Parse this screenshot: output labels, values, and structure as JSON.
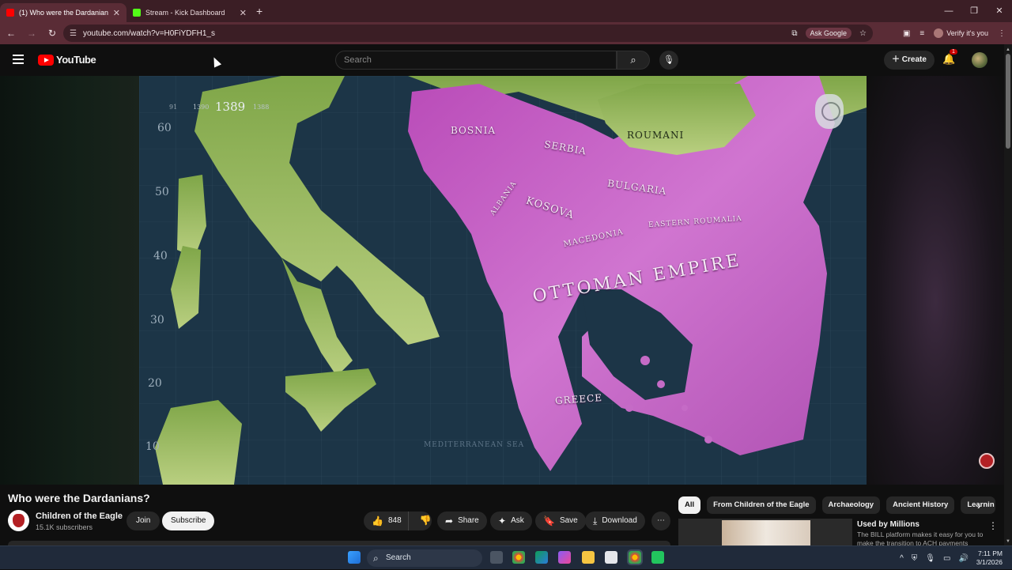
{
  "browser": {
    "tabs": [
      {
        "title": "(1) Who were the Dardanians?",
        "favicon_color": "#ff0000",
        "active": true
      },
      {
        "title": "Stream - Kick Dashboard",
        "favicon_color": "#53fc18",
        "active": false
      }
    ],
    "url": "youtube.com/watch?v=H0FiYDFH1_s",
    "ask_google": "Ask Google",
    "verify_label": "Verify it's you"
  },
  "youtube": {
    "logo_text": "YouTube",
    "search_placeholder": "Search",
    "create_label": "Create",
    "notification_count": "1"
  },
  "map": {
    "year": "1389",
    "year_prev": "1390",
    "year_prev2": "91",
    "year_next": "1388",
    "latitudes": [
      "60",
      "50",
      "40",
      "30",
      "20",
      "10"
    ],
    "labels": {
      "bosnia": "BOSNIA",
      "serbia": "SERBIA",
      "roumani": "ROUMANI",
      "bulgaria": "BULGARIA",
      "kosova": "KOSOVA",
      "macedonia": "MACEDONIA",
      "eastern_roumalia": "EASTERN ROUMALIA",
      "ottoman": "OTTOMAN EMPIRE",
      "greece": "GREECE",
      "albania": "ALBANIA",
      "sea": "MEDITERRANEAN SEA"
    },
    "colors": {
      "sea": "#1c3547",
      "land": "#a9c46a",
      "ottoman": "#c75bc8"
    }
  },
  "video": {
    "title": "Who were the Dardanians?",
    "channel": "Children of the Eagle",
    "subscribers": "15.1K subscribers",
    "join": "Join",
    "subscribe": "Subscribe",
    "likes": "848",
    "share": "Share",
    "ask": "Ask",
    "save": "Save",
    "download": "Download"
  },
  "sidebar": {
    "chips": [
      "All",
      "From Children of the Eagle",
      "Archaeology",
      "Ancient History",
      "Learnin"
    ],
    "recommended": {
      "title": "Used by Millions",
      "description": "The BILL platform makes it easy for you to make the transition to ACH payments"
    }
  },
  "taskbar": {
    "search": "Search",
    "time": "7:11 PM",
    "date": "3/1/2026"
  }
}
